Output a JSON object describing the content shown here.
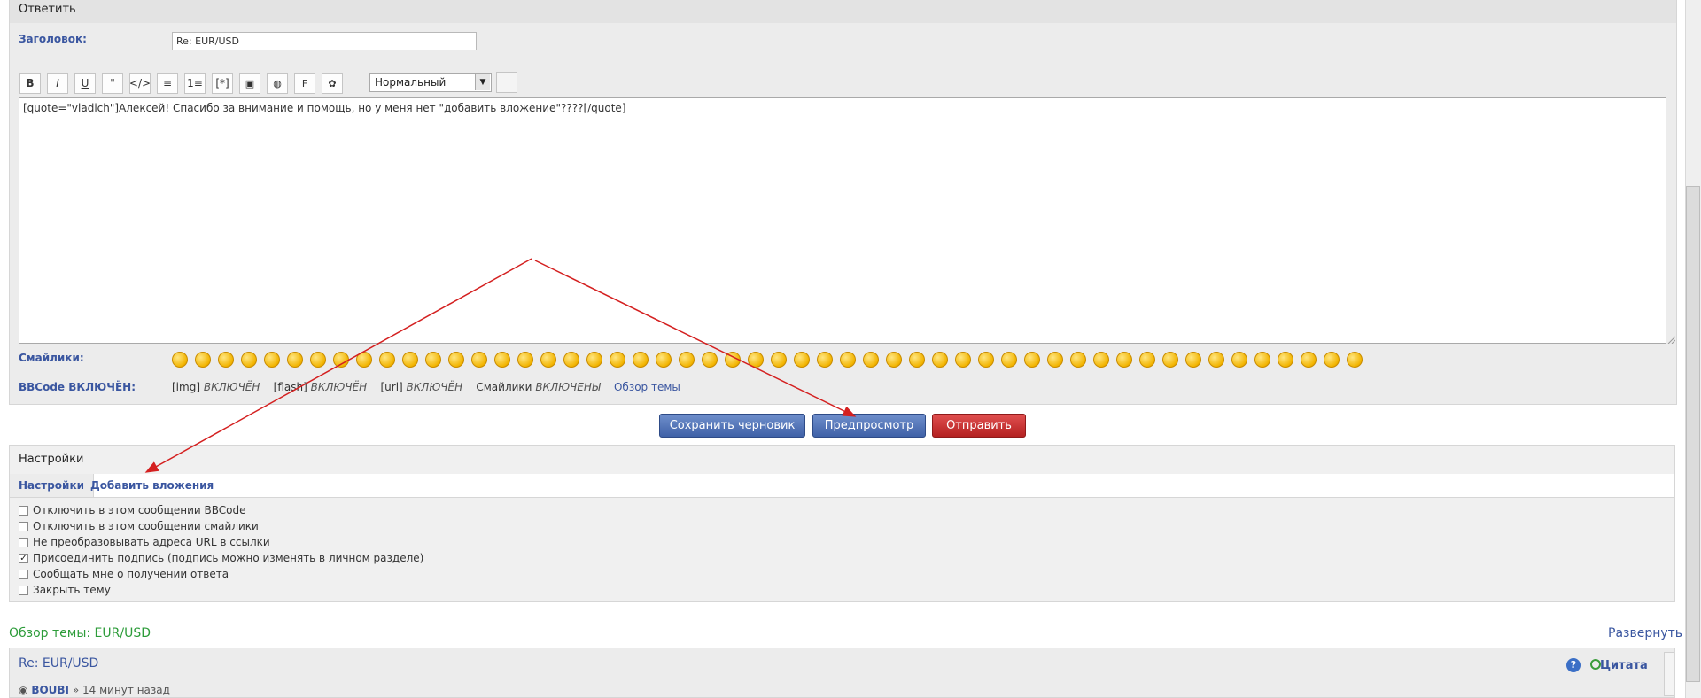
{
  "reply": {
    "title": "Ответить",
    "subject_label": "Заголовок:",
    "subject_value": "Re: EUR/USD",
    "font_size_select": "Нормальный",
    "toolbar_icons": [
      "bold-icon",
      "italic-icon",
      "underline-icon",
      "quote-icon",
      "code-icon",
      "list-icon",
      "ordered-list-icon",
      "list-item-icon",
      "image-icon",
      "url-icon",
      "flash-icon",
      "color-icon"
    ],
    "toolbar_labels": [
      "B",
      "I",
      "U",
      "\"",
      "</>",
      "≡",
      "1≡",
      "[*]",
      "▣",
      "◍",
      "F",
      "✿"
    ],
    "message_text": "[quote=\"vladich\"]Алексей! Спасибо за внимание и помощь, но у меня нет \"добавить вложение\"????[/quote]",
    "smilies_label": "Смайлики:",
    "bbcode_label": "BBCode ВКЛЮЧЁН:",
    "bbcode_status": {
      "img_prefix": "[img]",
      "img_value": "ВКЛЮЧЁН",
      "flash_prefix": "[flash]",
      "flash_value": "ВКЛЮЧЁН",
      "url_prefix": "[url]",
      "url_value": "ВКЛЮЧЁН",
      "smilies_prefix": "Смайлики",
      "smilies_value": "ВКЛЮЧЕНЫ",
      "topic_review_link": "Обзор темы"
    }
  },
  "buttons": {
    "save_draft": "Сохранить черновик",
    "preview": "Предпросмотр",
    "submit": "Отправить"
  },
  "settings": {
    "title": "Настройки",
    "tabs": [
      "Настройки",
      "Добавить вложения"
    ],
    "options": [
      {
        "label": "Отключить в этом сообщении BBCode",
        "checked": false
      },
      {
        "label": "Отключить в этом сообщении смайлики",
        "checked": false
      },
      {
        "label": "Не преобразовывать адреса URL в ссылки",
        "checked": false
      },
      {
        "label": "Присоединить подпись (подпись можно изменять в личном разделе)",
        "checked": true
      },
      {
        "label": "Сообщать мне о получении ответа",
        "checked": false
      },
      {
        "label": "Закрыть тему",
        "checked": false
      }
    ]
  },
  "topic_review": {
    "title": "Обзор темы: EUR/USD",
    "expand": "Развернуть",
    "post_subject": "Re: EUR/USD",
    "quote_button": "Цитата",
    "author": "BOUBI",
    "separator": "»",
    "time": "14 минут назад"
  },
  "colors": {
    "link": "#3a56a0",
    "green_title": "#2d9c3a",
    "primary_button": "#4a6bb0",
    "danger_button": "#c62b2b",
    "annotation_arrow": "#d42020"
  }
}
